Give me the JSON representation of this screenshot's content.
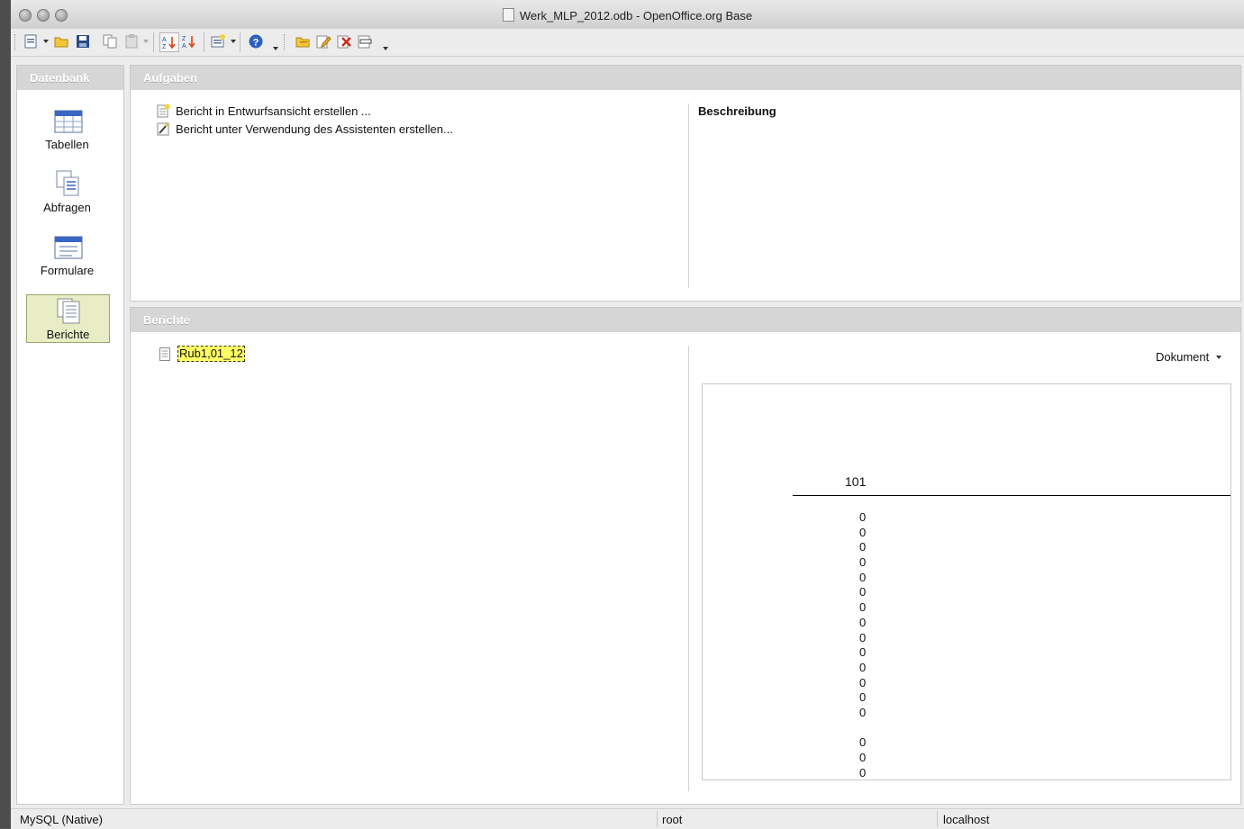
{
  "window": {
    "title": "Werk_MLP_2012.odb - OpenOffice.org Base"
  },
  "toolbar": {
    "buttons": [
      "new-icon",
      "open-icon",
      "save-icon",
      "copy-icon",
      "paste-icon",
      "sort-ascending-icon",
      "sort-descending-icon",
      "form-icon",
      "help-icon",
      "open-object-icon",
      "edit-icon",
      "delete-icon",
      "rename-icon"
    ]
  },
  "sidebar": {
    "header": "Datenbank",
    "items": [
      {
        "label": "Tabellen",
        "icon": "table-icon"
      },
      {
        "label": "Abfragen",
        "icon": "query-icon"
      },
      {
        "label": "Formulare",
        "icon": "form-icon"
      },
      {
        "label": "Berichte",
        "icon": "report-icon",
        "selected": true
      }
    ]
  },
  "tasks": {
    "header": "Aufgaben",
    "items": [
      {
        "label": "Bericht in Entwurfsansicht erstellen ...",
        "icon": "design-view-icon"
      },
      {
        "label": "Bericht unter Verwendung des Assistenten erstellen...",
        "icon": "wizard-icon"
      }
    ],
    "description_label": "Beschreibung"
  },
  "reports": {
    "header": "Berichte",
    "items": [
      {
        "label": "Rub1,01_12"
      }
    ],
    "preview_mode": "Dokument",
    "preview": {
      "header": "101",
      "values": [
        "0",
        "0",
        "0",
        "0",
        "0",
        "0",
        "0",
        "0",
        "0",
        "0",
        "0",
        "0",
        "0",
        "0",
        "",
        "0",
        "0",
        "0"
      ]
    }
  },
  "statusbar": {
    "driver": "MySQL (Native)",
    "user": "root",
    "host": "localhost"
  },
  "colors": {
    "selected_bg": "#e8edc6",
    "header_bg": "#d6d6d6",
    "highlight": "#ffff66"
  }
}
